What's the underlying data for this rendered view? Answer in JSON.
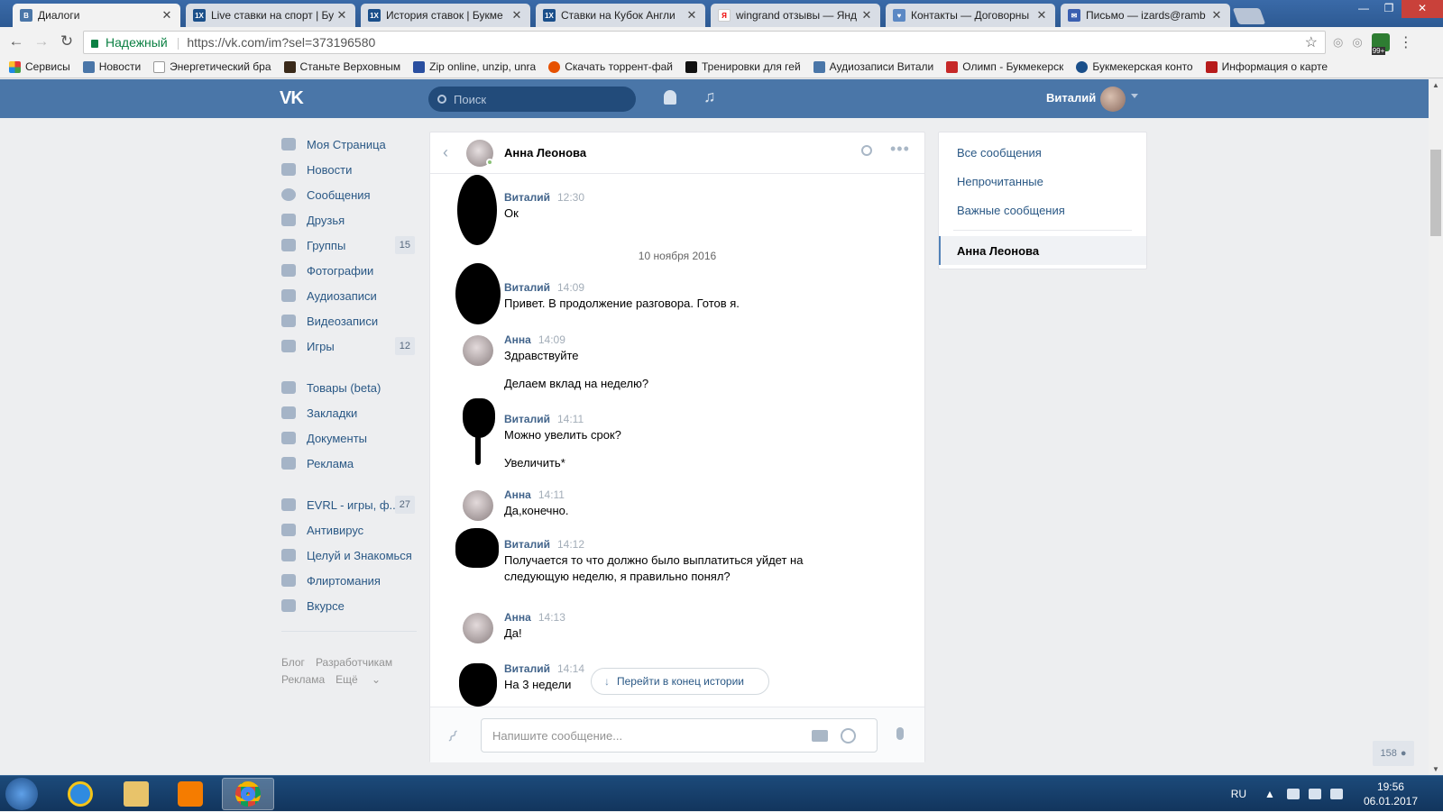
{
  "browser": {
    "tabs": [
      {
        "title": "Диалоги",
        "active": true,
        "icon": "vk-icon"
      },
      {
        "title": "Live ставки на спорт | Бу",
        "active": false,
        "icon": "1x-icon"
      },
      {
        "title": "История ставок | Букме",
        "active": false,
        "icon": "1x-icon"
      },
      {
        "title": "Ставки на Кубок Англи",
        "active": false,
        "icon": "1x-icon"
      },
      {
        "title": "wingrand отзывы — Янд",
        "active": false,
        "icon": "yandex-icon"
      },
      {
        "title": "Контакты — Договорны",
        "active": false,
        "icon": "like-icon"
      },
      {
        "title": "Письмо — izards@ramb",
        "active": false,
        "icon": "mail-icon"
      }
    ],
    "secure_label": "Надежный",
    "url": "https://vk.com/im?sel=373196580",
    "ext_badge": "99+",
    "bookmarks": [
      "Сервисы",
      "Новости",
      "Энергетический бра",
      "Станьте Верховным",
      "Zip online, unzip, unra",
      "Скачать торрент-фай",
      "Тренировки для гей",
      "Аудиозаписи Витали",
      "Олимп - Букмекерск",
      "Букмекерская конто",
      "Информация о карте"
    ]
  },
  "vk": {
    "search_placeholder": "Поиск",
    "user_name": "Виталий",
    "menu": [
      {
        "label": "Моя Страница",
        "count": ""
      },
      {
        "label": "Новости",
        "count": ""
      },
      {
        "label": "Сообщения",
        "count": ""
      },
      {
        "label": "Друзья",
        "count": ""
      },
      {
        "label": "Группы",
        "count": "15"
      },
      {
        "label": "Фотографии",
        "count": ""
      },
      {
        "label": "Аудиозаписи",
        "count": ""
      },
      {
        "label": "Видеозаписи",
        "count": ""
      },
      {
        "label": "Игры",
        "count": "12"
      }
    ],
    "menu2": [
      {
        "label": "Товары (beta)"
      },
      {
        "label": "Закладки"
      },
      {
        "label": "Документы"
      },
      {
        "label": "Реклама"
      }
    ],
    "apps": [
      {
        "label": "EVRL - игры, ф...",
        "count": "27"
      },
      {
        "label": "Антивирус",
        "count": ""
      },
      {
        "label": "Целуй и Знакомься",
        "count": ""
      },
      {
        "label": "Флиртомания",
        "count": ""
      },
      {
        "label": "Вкурсе",
        "count": ""
      }
    ],
    "footer": {
      "blog": "Блог",
      "dev": "Разработчикам",
      "ads": "Реклама",
      "more": "Ещё"
    },
    "chat": {
      "contact_name": "Анна Леонова",
      "date_separator": "10 ноября 2016",
      "messages": [
        {
          "author": "Виталий",
          "time": "12:30",
          "text": "Ок"
        },
        {
          "author": "Виталий",
          "time": "14:09",
          "text": "Привет. В продолжение разговора. Готов я."
        },
        {
          "author": "Анна",
          "time": "14:09",
          "text": "Здравствуйте",
          "text2": "Делаем вклад на неделю?"
        },
        {
          "author": "Виталий",
          "time": "14:11",
          "text": "Можно увелить срок?",
          "text2": "Увеличить*"
        },
        {
          "author": "Анна",
          "time": "14:11",
          "text": "Да,конечно."
        },
        {
          "author": "Виталий",
          "time": "14:12",
          "text": "Получается то что должно было выплатиться уйдет на следующую неделю, я правильно понял?"
        },
        {
          "author": "Анна",
          "time": "14:13",
          "text": "Да!"
        },
        {
          "author": "Виталий",
          "time": "14:14",
          "text": "На 3 недели"
        }
      ],
      "jump_label": "Перейти в конец истории",
      "compose_placeholder": "Напишите сообщение..."
    },
    "right_menu": {
      "all": "Все сообщения",
      "unread": "Непрочитанные",
      "important": "Важные сообщения",
      "selected": "Анна Леонова"
    },
    "online_counter": "158"
  },
  "taskbar": {
    "lang": "RU",
    "time": "19:56",
    "date": "06.01.2017"
  }
}
